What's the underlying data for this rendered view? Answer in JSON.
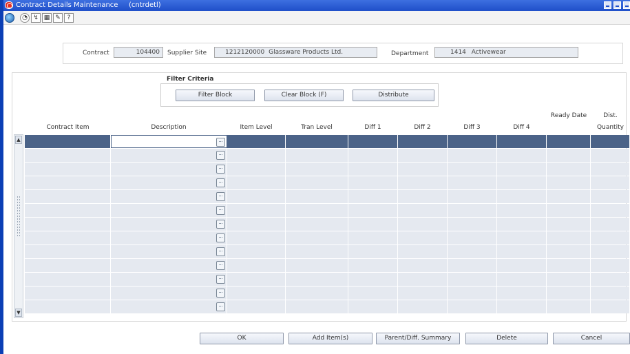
{
  "window": {
    "title": "Contract Details Maintenance",
    "form_code": "(cntrdetl)"
  },
  "toolbar": {
    "icons": [
      "globe-icon",
      "help-icon",
      "zoom-icon",
      "calendar-icon",
      "edit-icon",
      "info-icon"
    ]
  },
  "header": {
    "contract_label": "Contract",
    "contract_value": "104400",
    "supplier_site_label": "Supplier Site",
    "supplier_site_id": "1212120000",
    "supplier_site_name": "Glassware Products Ltd.",
    "department_label": "Department",
    "department_id": "1414",
    "department_name": "Activewear"
  },
  "filter": {
    "title": "Filter Criteria",
    "filter_block": "Filter Block",
    "clear_block": "Clear Block  (F)",
    "distribute": "Distribute"
  },
  "grid": {
    "columns": {
      "contract_item": "Contract Item",
      "description": "Description",
      "item_level": "Item Level",
      "tran_level": "Tran Level",
      "diff1": "Diff 1",
      "diff2": "Diff 2",
      "diff3": "Diff 3",
      "diff4": "Diff 4",
      "ready_date": "Ready Date",
      "dist_quantity_line1": "Dist.",
      "dist_quantity_line2": "Quantity"
    },
    "row_count": 13,
    "selected_row": 0
  },
  "buttons": {
    "ok": "OK",
    "add_items": "Add Item(s)",
    "parent_diff_summary": "Parent/Diff. Summary",
    "delete": "Delete",
    "cancel": "Cancel"
  },
  "colors": {
    "titlebar": "#1f4fc9",
    "selected_row": "#4b6388",
    "grid_cell": "#e5e9f0"
  }
}
